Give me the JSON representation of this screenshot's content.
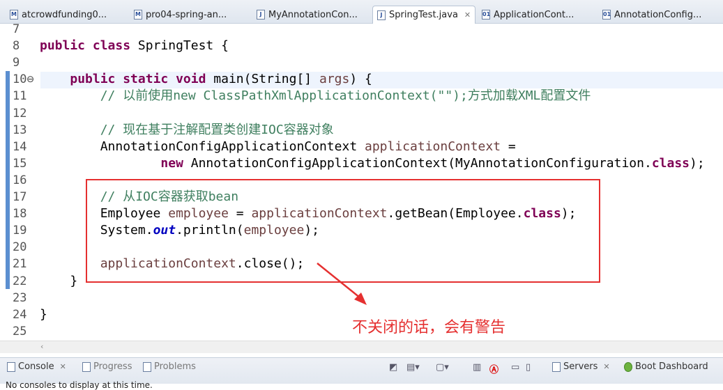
{
  "tabs": [
    {
      "label": "atcrowdfunding0...",
      "icon": "maven-pom-icon",
      "active": false
    },
    {
      "label": "pro04-spring-an...",
      "icon": "maven-pom-icon",
      "active": false
    },
    {
      "label": "MyAnnotationCon...",
      "icon": "java-file-icon",
      "active": false
    },
    {
      "label": "SpringTest.java",
      "icon": "java-file-icon",
      "active": true
    },
    {
      "label": "ApplicationCont...",
      "icon": "class-file-icon",
      "active": false
    },
    {
      "label": "AnnotationConfig...",
      "icon": "class-file-icon",
      "active": false
    }
  ],
  "close_glyph": "✕",
  "lines": [
    {
      "n": "7",
      "t": []
    },
    {
      "n": "8",
      "t": [
        [
          "public class ",
          "kw"
        ],
        [
          "SpringTest {",
          ""
        ]
      ]
    },
    {
      "n": "9",
      "t": []
    },
    {
      "n": "10⊖",
      "t": [
        [
          "    ",
          ""
        ],
        [
          "public static void ",
          "kw"
        ],
        [
          "main(String[] ",
          ""
        ],
        [
          "args",
          "var"
        ],
        [
          ") {",
          ""
        ]
      ]
    },
    {
      "n": "11",
      "t": [
        [
          "        ",
          ""
        ],
        [
          "// 以前使用new ClassPathXmlApplicationContext(\"\");方式加载XML配置文件",
          "cm"
        ]
      ]
    },
    {
      "n": "12",
      "t": []
    },
    {
      "n": "13",
      "t": [
        [
          "        ",
          ""
        ],
        [
          "// 现在基于注解配置类创建IOC容器对象",
          "cm"
        ]
      ]
    },
    {
      "n": "14",
      "t": [
        [
          "        AnnotationConfigApplicationContext ",
          ""
        ],
        [
          "applicationContext",
          "var"
        ],
        [
          " =",
          ""
        ]
      ]
    },
    {
      "n": "15",
      "t": [
        [
          "                ",
          ""
        ],
        [
          "new ",
          "kw"
        ],
        [
          "AnnotationConfigApplicationContext(MyAnnotationConfiguration.",
          ""
        ],
        [
          "class",
          "kw"
        ],
        [
          ");",
          ""
        ]
      ]
    },
    {
      "n": "16",
      "t": []
    },
    {
      "n": "17",
      "t": [
        [
          "        ",
          ""
        ],
        [
          "// 从IOC容器获取bean",
          "cm"
        ]
      ]
    },
    {
      "n": "18",
      "t": [
        [
          "        Employee ",
          ""
        ],
        [
          "employee",
          "var"
        ],
        [
          " = ",
          ""
        ],
        [
          "applicationContext",
          "var"
        ],
        [
          ".getBean(Employee.",
          ""
        ],
        [
          "class",
          "kw"
        ],
        [
          ");",
          ""
        ]
      ]
    },
    {
      "n": "19",
      "t": [
        [
          "        System.",
          ""
        ],
        [
          "out",
          "st"
        ],
        [
          ".println(",
          ""
        ],
        [
          "employee",
          "var"
        ],
        [
          ");",
          ""
        ]
      ]
    },
    {
      "n": "20",
      "t": []
    },
    {
      "n": "21",
      "t": [
        [
          "        ",
          ""
        ],
        [
          "applicationContext",
          "var"
        ],
        [
          ".close();",
          ""
        ]
      ]
    },
    {
      "n": "22",
      "t": [
        [
          "    }",
          ""
        ]
      ]
    },
    {
      "n": "23",
      "t": []
    },
    {
      "n": "24",
      "t": [
        [
          "}",
          ""
        ]
      ]
    },
    {
      "n": "25",
      "t": []
    }
  ],
  "annotation": "不关闭的话，会有警告",
  "colors": {
    "annotation": "#e53030",
    "keyword": "#7f0055",
    "comment": "#3f7f5f"
  },
  "bottom": {
    "tabs": [
      {
        "label": "Console",
        "icon": "console-icon"
      },
      {
        "label": "Progress",
        "icon": "progress-icon"
      },
      {
        "label": "Problems",
        "icon": "problems-icon"
      }
    ],
    "right_tabs": [
      {
        "label": "Servers",
        "icon": "servers-icon"
      },
      {
        "label": "Boot Dashboard",
        "icon": "boot-dashboard-icon"
      }
    ],
    "console_text": "No consoles to display at this time."
  }
}
